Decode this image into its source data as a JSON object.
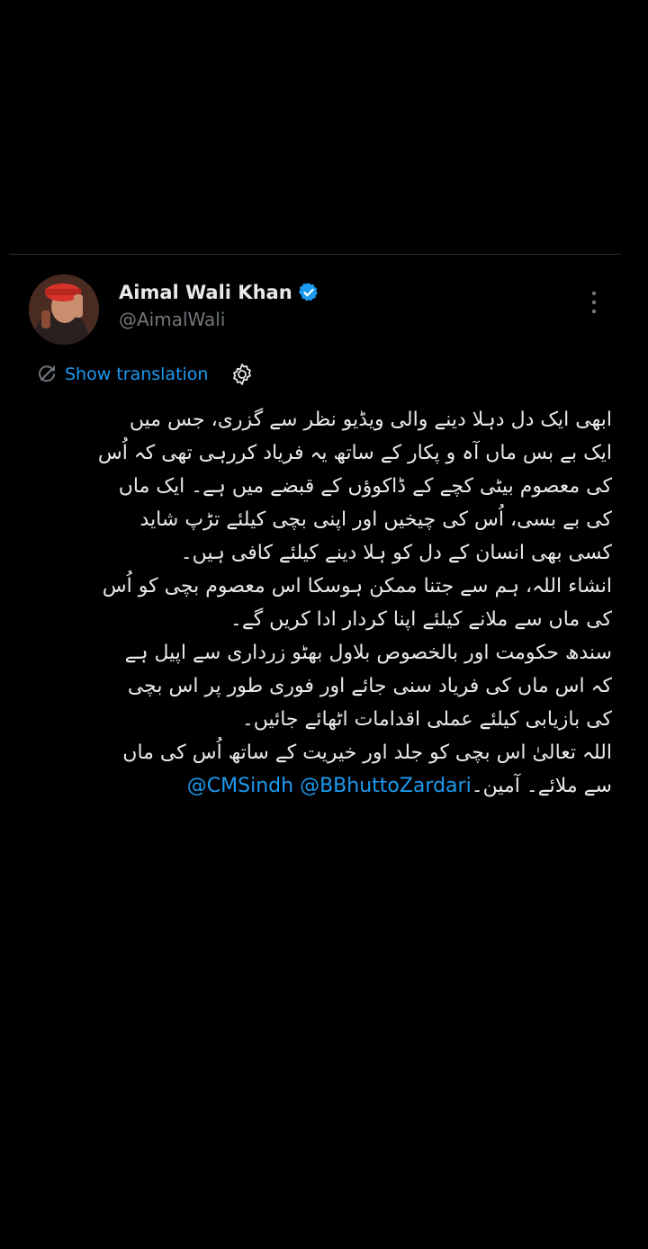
{
  "tweet": {
    "display_name": "Aimal Wali Khan",
    "handle": "@AimalWali",
    "verified": true,
    "show_translation_label": "Show translation",
    "body_lines": [
      "ابھی ایک دل دہلا دینے والی ویڈیو نظر سے گزری، جس میں",
      "ایک بے بس ماں آہ و پکار کے ساتھ یہ فریاد کررہی تھی کہ اُس",
      "کی معصوم بیٹی کچے کے ڈاکوؤں کے قبضے میں ہے۔ ایک ماں",
      "کی بے بسی، اُس کی چیخیں اور اپنی بچی کیلئے تڑپ شاید",
      "کسی بھی انسان کے دل کو ہلا دینے کیلئے کافی ہیں۔",
      "انشاء اللہ، ہم سے جتنا ممکن ہوسکا اس معصوم بچی کو اُس",
      "کی ماں سے ملانے کیلئے اپنا کردار ادا کریں گے۔",
      "سندھ حکومت اور بالخصوص بلاول بھٹو زرداری سے اپیل ہے",
      "کہ اس ماں کی فریاد سنی جائے اور فوری طور پر اس بچی",
      "کی بازیابی کیلئے عملی اقدامات اٹھائے جائیں۔",
      "اللہ تعالیٰ اس بچی کو جلد اور خیریت کے ساتھ اُس کی ماں"
    ],
    "last_line_text": "سے ملائے۔ آمین۔",
    "mentions": [
      "@CMSindh",
      "@BBhuttoZardari"
    ]
  },
  "icons": {
    "verified": "verified-badge-icon",
    "more": "more-vertical-icon",
    "translate": "translate-icon",
    "settings": "gear-icon"
  },
  "colors": {
    "background": "#000000",
    "text": "#e7e9ea",
    "secondary": "#71767b",
    "accent": "#1d9bf0"
  }
}
